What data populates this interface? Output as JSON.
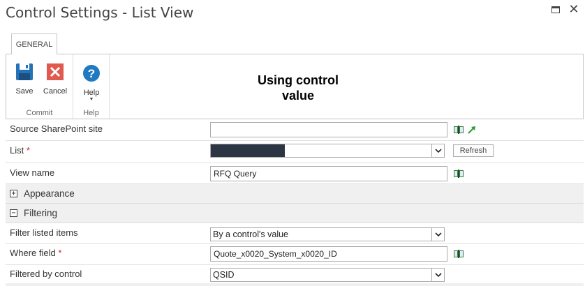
{
  "window": {
    "title": "Control Settings - List View"
  },
  "ribbon": {
    "tab_label": "GENERAL",
    "save_label": "Save",
    "cancel_label": "Cancel",
    "commit_group_label": "Commit",
    "help_label": "Help",
    "help_group_label": "Help"
  },
  "annotation": {
    "line1": "Using control",
    "line2": "value"
  },
  "form": {
    "source_site": {
      "label": "Source SharePoint site",
      "value": ""
    },
    "list": {
      "label": "List",
      "required_marker": "*",
      "value": "",
      "refresh_label": "Refresh"
    },
    "view_name": {
      "label": "View name",
      "value": "RFQ Query"
    },
    "appearance": {
      "title": "Appearance",
      "toggle": "+"
    },
    "filtering": {
      "title": "Filtering",
      "toggle": "−"
    },
    "filter_listed_items": {
      "label": "Filter listed items",
      "value": "By a control's value"
    },
    "where_field": {
      "label": "Where field",
      "required_marker": "*",
      "value": "Quote_x0020_System_x0020_ID"
    },
    "filtered_by_control": {
      "label": "Filtered by control",
      "value": "QSID"
    }
  },
  "colors": {
    "save_blue": "#2672b6",
    "cancel_red": "#e05a4f",
    "help_blue": "#1f7ac2",
    "required_red": "#c1272d",
    "redacted_bar": "#2b3544"
  },
  "icons": [
    "maximize-icon",
    "close-icon",
    "save-icon",
    "cancel-icon",
    "help-icon",
    "chevron-down-icon",
    "address-book-icon",
    "green-arrow-icon"
  ]
}
